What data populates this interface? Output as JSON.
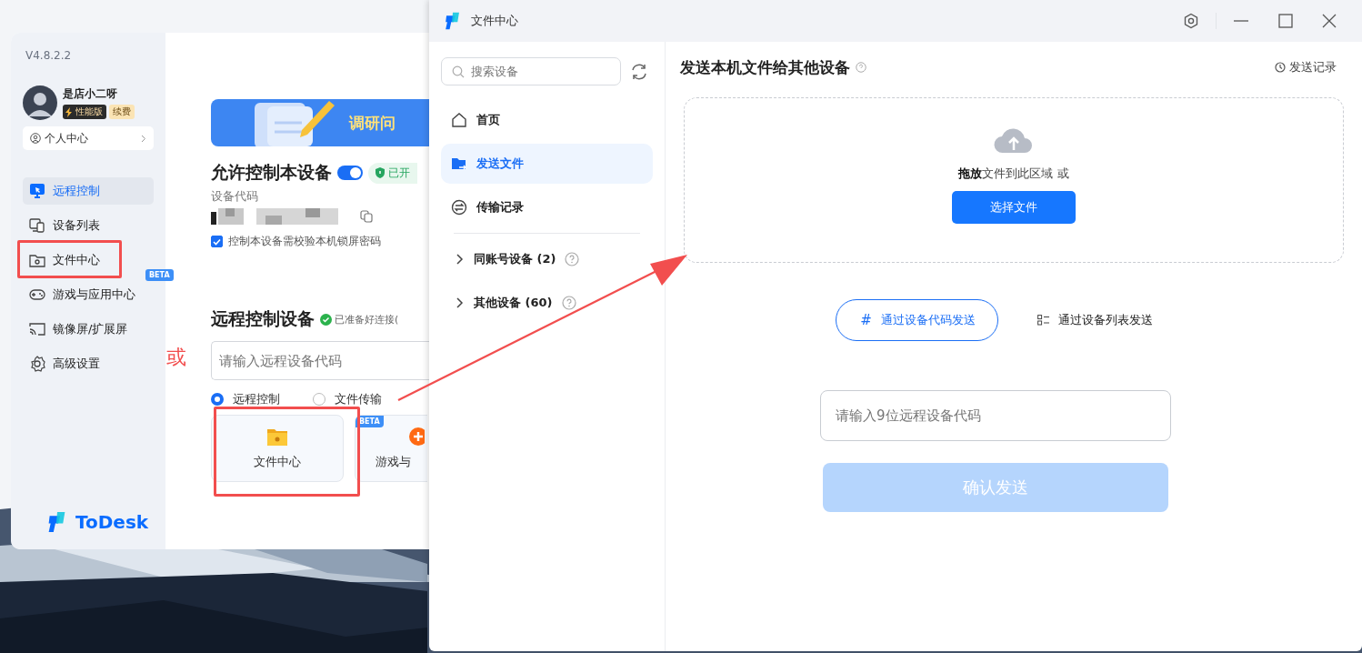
{
  "main_window": {
    "version": "V4.8.2.2",
    "user": {
      "name": "是店小二呀",
      "tier": "性能版",
      "renew": "续费"
    },
    "profile_link": "个人中心",
    "nav": [
      {
        "label": "远程控制",
        "selected": true
      },
      {
        "label": "设备列表",
        "selected": false
      },
      {
        "label": "文件中心",
        "selected": false
      },
      {
        "label": "游戏与应用中心",
        "selected": false,
        "badge": "BETA"
      },
      {
        "label": "镜像屏/扩展屏",
        "selected": false
      },
      {
        "label": "高级设置",
        "selected": false
      }
    ],
    "logo": "ToDesk",
    "banner": "调研问",
    "allow_control": {
      "title": "允许控制本设备",
      "on": true,
      "status": "已开"
    },
    "device_code_label": "设备代码",
    "lock_password": {
      "label": "控制本设备需校验本机锁屏密码",
      "checked": true
    },
    "remote": {
      "title": "远程控制设备",
      "status": "已准备好连接(",
      "placeholder": "请输入远程设备代码",
      "modes": [
        {
          "label": "远程控制",
          "selected": true
        },
        {
          "label": "文件传输",
          "selected": false
        }
      ]
    },
    "cards": [
      {
        "label": "文件中心"
      },
      {
        "label": "游戏与",
        "badge": "BETA"
      }
    ]
  },
  "annotation": {
    "text": "或"
  },
  "file_window": {
    "title": "文件中心",
    "search": {
      "placeholder": "搜索设备"
    },
    "nav": [
      {
        "label": "首页",
        "selected": false
      },
      {
        "label": "发送文件",
        "selected": true
      },
      {
        "label": "传输记录",
        "selected": false
      }
    ],
    "groups": [
      {
        "label": "同账号设备 (2)",
        "expanded": false
      },
      {
        "label": "其他设备 (60)",
        "expanded": false
      }
    ],
    "heading": "发送本机文件给其他设备",
    "history": "发送记录",
    "drop_text": "**拖放**文件到此区域 或",
    "choose_button": "选择文件",
    "methods": [
      {
        "icon": "#",
        "label": "通过设备代码发送",
        "selected": true
      },
      {
        "label": "通过设备列表发送",
        "selected": false
      }
    ],
    "code_input": {
      "placeholder": "请输入9位远程设备代码"
    },
    "confirm": {
      "label": "确认发送",
      "disabled": true
    }
  }
}
